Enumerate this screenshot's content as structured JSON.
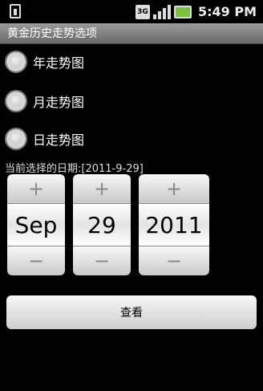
{
  "status_bar": {
    "network_type": "3G",
    "time": "5:49 PM",
    "icons": [
      "sim-icon",
      "network-3g-icon",
      "signal-icon",
      "battery-icon"
    ],
    "battery_color": "#7ac142"
  },
  "title_bar": {
    "title": "黄金历史走势选项"
  },
  "options": [
    {
      "label": "年走势图",
      "checked": false
    },
    {
      "label": "月走势图",
      "checked": false
    },
    {
      "label": "日走势图",
      "checked": false
    }
  ],
  "date_caption": "当前选择的日期:[2011-9-29]",
  "date_picker": {
    "month": "Sep",
    "day": "29",
    "year": "2011",
    "increment_symbol": "+",
    "decrement_symbol": "−"
  },
  "view_button": {
    "label": "查看"
  }
}
